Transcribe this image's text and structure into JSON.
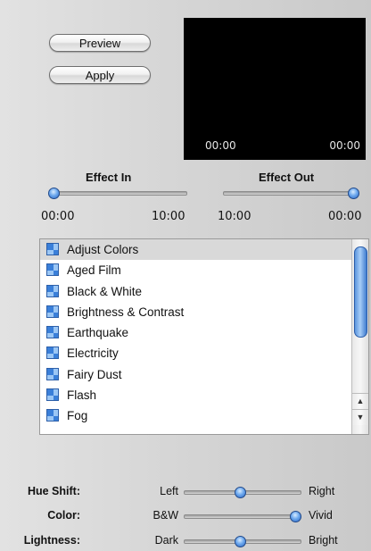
{
  "buttons": {
    "preview": "Preview",
    "apply": "Apply"
  },
  "monitor": {
    "time_in": "00:00",
    "time_out": "00:00"
  },
  "effect_in": {
    "label": "Effect In",
    "start": "00:00",
    "end": "10:00",
    "value": 0
  },
  "effect_out": {
    "label": "Effect Out",
    "start": "10:00",
    "end": "00:00",
    "value": 1
  },
  "effects_list": {
    "selected_index": 0,
    "items": [
      "Adjust Colors",
      "Aged Film",
      "Black & White",
      "Brightness & Contrast",
      "Earthquake",
      "Electricity",
      "Fairy Dust",
      "Flash",
      "Fog"
    ]
  },
  "adjustments": [
    {
      "label": "Hue Shift:",
      "min": "Left",
      "max": "Right",
      "value": 0.5
    },
    {
      "label": "Color:",
      "min": "B&W",
      "max": "Vivid",
      "value": 1.0
    },
    {
      "label": "Lightness:",
      "min": "Dark",
      "max": "Bright",
      "value": 0.5
    }
  ],
  "colors": {
    "accent": "#3a7fd9",
    "selection": "#d9d9d9",
    "monitor": "#000000"
  }
}
